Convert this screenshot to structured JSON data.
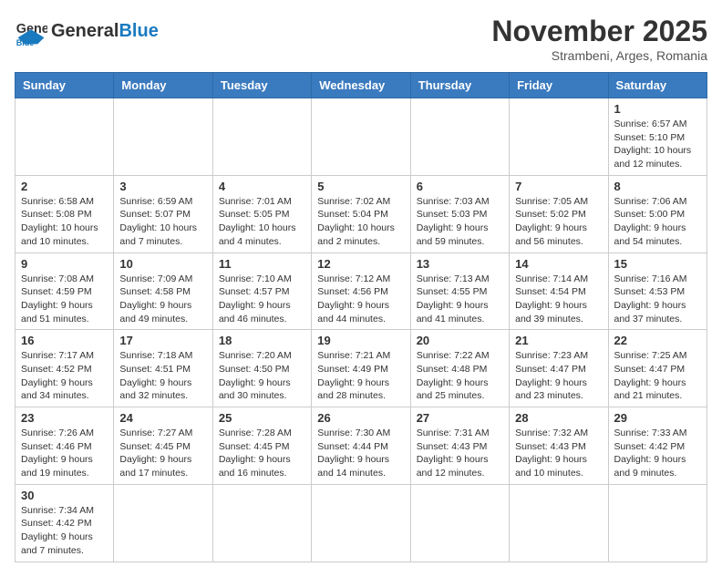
{
  "header": {
    "logo_text_regular": "General",
    "logo_text_blue": "Blue",
    "month_title": "November 2025",
    "subtitle": "Strambeni, Arges, Romania"
  },
  "weekdays": [
    "Sunday",
    "Monday",
    "Tuesday",
    "Wednesday",
    "Thursday",
    "Friday",
    "Saturday"
  ],
  "weeks": [
    [
      {
        "day": "",
        "info": ""
      },
      {
        "day": "",
        "info": ""
      },
      {
        "day": "",
        "info": ""
      },
      {
        "day": "",
        "info": ""
      },
      {
        "day": "",
        "info": ""
      },
      {
        "day": "",
        "info": ""
      },
      {
        "day": "1",
        "info": "Sunrise: 6:57 AM\nSunset: 5:10 PM\nDaylight: 10 hours and 12 minutes."
      }
    ],
    [
      {
        "day": "2",
        "info": "Sunrise: 6:58 AM\nSunset: 5:08 PM\nDaylight: 10 hours and 10 minutes."
      },
      {
        "day": "3",
        "info": "Sunrise: 6:59 AM\nSunset: 5:07 PM\nDaylight: 10 hours and 7 minutes."
      },
      {
        "day": "4",
        "info": "Sunrise: 7:01 AM\nSunset: 5:05 PM\nDaylight: 10 hours and 4 minutes."
      },
      {
        "day": "5",
        "info": "Sunrise: 7:02 AM\nSunset: 5:04 PM\nDaylight: 10 hours and 2 minutes."
      },
      {
        "day": "6",
        "info": "Sunrise: 7:03 AM\nSunset: 5:03 PM\nDaylight: 9 hours and 59 minutes."
      },
      {
        "day": "7",
        "info": "Sunrise: 7:05 AM\nSunset: 5:02 PM\nDaylight: 9 hours and 56 minutes."
      },
      {
        "day": "8",
        "info": "Sunrise: 7:06 AM\nSunset: 5:00 PM\nDaylight: 9 hours and 54 minutes."
      }
    ],
    [
      {
        "day": "9",
        "info": "Sunrise: 7:08 AM\nSunset: 4:59 PM\nDaylight: 9 hours and 51 minutes."
      },
      {
        "day": "10",
        "info": "Sunrise: 7:09 AM\nSunset: 4:58 PM\nDaylight: 9 hours and 49 minutes."
      },
      {
        "day": "11",
        "info": "Sunrise: 7:10 AM\nSunset: 4:57 PM\nDaylight: 9 hours and 46 minutes."
      },
      {
        "day": "12",
        "info": "Sunrise: 7:12 AM\nSunset: 4:56 PM\nDaylight: 9 hours and 44 minutes."
      },
      {
        "day": "13",
        "info": "Sunrise: 7:13 AM\nSunset: 4:55 PM\nDaylight: 9 hours and 41 minutes."
      },
      {
        "day": "14",
        "info": "Sunrise: 7:14 AM\nSunset: 4:54 PM\nDaylight: 9 hours and 39 minutes."
      },
      {
        "day": "15",
        "info": "Sunrise: 7:16 AM\nSunset: 4:53 PM\nDaylight: 9 hours and 37 minutes."
      }
    ],
    [
      {
        "day": "16",
        "info": "Sunrise: 7:17 AM\nSunset: 4:52 PM\nDaylight: 9 hours and 34 minutes."
      },
      {
        "day": "17",
        "info": "Sunrise: 7:18 AM\nSunset: 4:51 PM\nDaylight: 9 hours and 32 minutes."
      },
      {
        "day": "18",
        "info": "Sunrise: 7:20 AM\nSunset: 4:50 PM\nDaylight: 9 hours and 30 minutes."
      },
      {
        "day": "19",
        "info": "Sunrise: 7:21 AM\nSunset: 4:49 PM\nDaylight: 9 hours and 28 minutes."
      },
      {
        "day": "20",
        "info": "Sunrise: 7:22 AM\nSunset: 4:48 PM\nDaylight: 9 hours and 25 minutes."
      },
      {
        "day": "21",
        "info": "Sunrise: 7:23 AM\nSunset: 4:47 PM\nDaylight: 9 hours and 23 minutes."
      },
      {
        "day": "22",
        "info": "Sunrise: 7:25 AM\nSunset: 4:47 PM\nDaylight: 9 hours and 21 minutes."
      }
    ],
    [
      {
        "day": "23",
        "info": "Sunrise: 7:26 AM\nSunset: 4:46 PM\nDaylight: 9 hours and 19 minutes."
      },
      {
        "day": "24",
        "info": "Sunrise: 7:27 AM\nSunset: 4:45 PM\nDaylight: 9 hours and 17 minutes."
      },
      {
        "day": "25",
        "info": "Sunrise: 7:28 AM\nSunset: 4:45 PM\nDaylight: 9 hours and 16 minutes."
      },
      {
        "day": "26",
        "info": "Sunrise: 7:30 AM\nSunset: 4:44 PM\nDaylight: 9 hours and 14 minutes."
      },
      {
        "day": "27",
        "info": "Sunrise: 7:31 AM\nSunset: 4:43 PM\nDaylight: 9 hours and 12 minutes."
      },
      {
        "day": "28",
        "info": "Sunrise: 7:32 AM\nSunset: 4:43 PM\nDaylight: 9 hours and 10 minutes."
      },
      {
        "day": "29",
        "info": "Sunrise: 7:33 AM\nSunset: 4:42 PM\nDaylight: 9 hours and 9 minutes."
      }
    ],
    [
      {
        "day": "30",
        "info": "Sunrise: 7:34 AM\nSunset: 4:42 PM\nDaylight: 9 hours and 7 minutes."
      },
      {
        "day": "",
        "info": ""
      },
      {
        "day": "",
        "info": ""
      },
      {
        "day": "",
        "info": ""
      },
      {
        "day": "",
        "info": ""
      },
      {
        "day": "",
        "info": ""
      },
      {
        "day": "",
        "info": ""
      }
    ]
  ]
}
